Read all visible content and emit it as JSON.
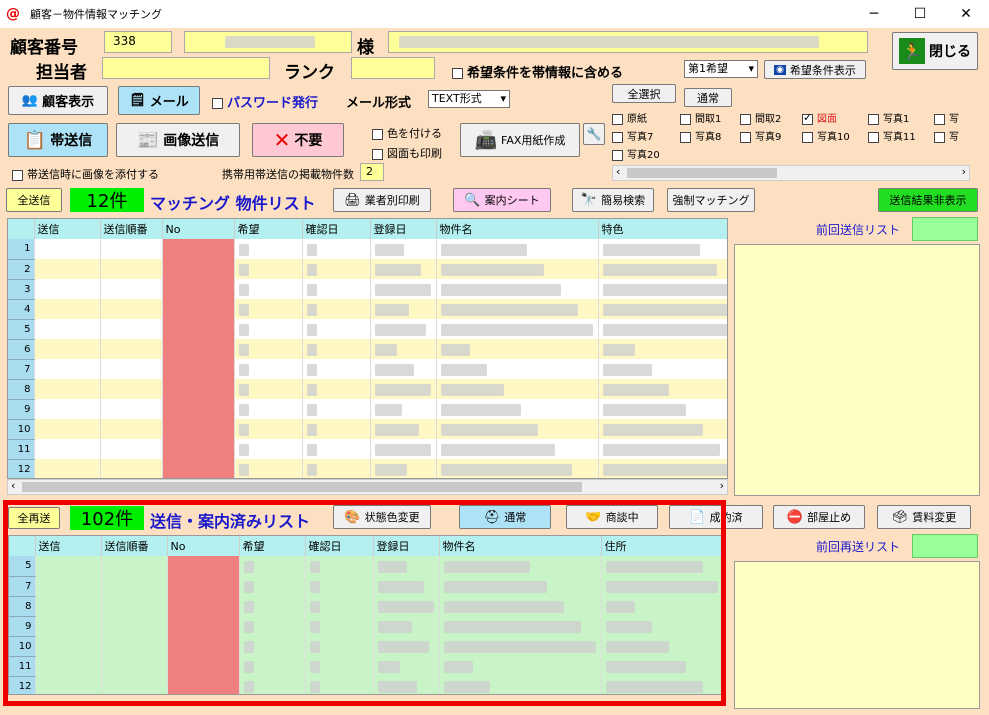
{
  "window": {
    "title": "顧客－物件情報マッチング",
    "minimize": "─",
    "maximize": "☐",
    "close": "✕"
  },
  "header": {
    "customer_no_label": "顧客番号",
    "customer_no_value": "338",
    "sama_label": "様",
    "tanto_label": "担当者",
    "rank_label": "ランク",
    "include_hope_label": "希望条件を帯情報に含める",
    "hope_select": "第1希望",
    "hope_show_btn": "希望条件表示",
    "close_btn": "閉じる"
  },
  "toolbar": {
    "customer_show": "顧客表示",
    "mail": "メール",
    "password_issue": "パスワード発行",
    "mail_format_label": "メール形式",
    "mail_format_value": "TEXT形式",
    "select_all": "全選択",
    "normal": "通常",
    "obi_send": "帯送信",
    "image_send": "画像送信",
    "unneeded": "不要",
    "color_label": "色を付ける",
    "zumen_print_label": "図面も印刷",
    "fax_btn": "FAX用紙作成",
    "attach_image_label": "帯送信時に画像を添付する",
    "mobile_count_label": "携帯用帯送信の掲載物件数",
    "mobile_count_value": "2"
  },
  "image_checks": [
    {
      "label": "原紙",
      "checked": false
    },
    {
      "label": "間取1",
      "checked": false
    },
    {
      "label": "間取2",
      "checked": false
    },
    {
      "label": "図面",
      "checked": true
    },
    {
      "label": "写真1",
      "checked": false
    },
    {
      "label": "写",
      "checked": false
    },
    {
      "label": "写真7",
      "checked": false
    },
    {
      "label": "写真8",
      "checked": false
    },
    {
      "label": "写真9",
      "checked": false
    },
    {
      "label": "写真10",
      "checked": false
    },
    {
      "label": "写真11",
      "checked": false
    },
    {
      "label": "写",
      "checked": false
    },
    {
      "label": "写真20",
      "checked": false
    }
  ],
  "matching": {
    "send_all": "全送信",
    "count": "12件",
    "title": "マッチング 物件リスト",
    "print_by_company": "業者別印刷",
    "guide_sheet": "案内シート",
    "simple_search": "簡易検索",
    "force_match": "強制マッチング",
    "hide_result": "送信結果非表示",
    "columns": [
      "送信",
      "送信順番",
      "No",
      "希望",
      "確認日",
      "登録日",
      "物件名",
      "特色"
    ],
    "rows": [
      "1",
      "2",
      "3",
      "4",
      "5",
      "6",
      "7",
      "8",
      "9",
      "10",
      "11",
      "12"
    ],
    "prev_list_label": "前回送信リスト"
  },
  "sent": {
    "resend_all": "全再送",
    "count": "102件",
    "title": "送信・案内済みリスト",
    "status_color": "状態色変更",
    "btn_normal": "通常",
    "btn_negotiating": "商談中",
    "btn_contracted": "成約済",
    "btn_room_stop": "部屋止め",
    "btn_rent_change": "賃料変更",
    "columns": [
      "送信",
      "送信順番",
      "No",
      "希望",
      "確認日",
      "登録日",
      "物件名",
      "住所"
    ],
    "rows": [
      "5",
      "7",
      "8",
      "9",
      "10",
      "11",
      "12"
    ],
    "prev_resend_label": "前回再送リスト"
  }
}
